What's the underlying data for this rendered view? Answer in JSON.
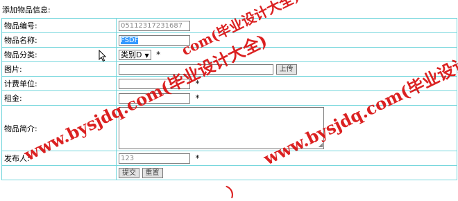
{
  "heading": "添加物品信息:",
  "fields": {
    "code": {
      "label": "物品编号:",
      "value": "05112317231687"
    },
    "name": {
      "label": "物品名称:",
      "value": "FSDF"
    },
    "category": {
      "label": "物品分类:",
      "selected": "类别D"
    },
    "image": {
      "label": "图片:",
      "value": "",
      "upload_label": "上传"
    },
    "unit": {
      "label": "计费单位:",
      "value": ""
    },
    "rent": {
      "label": "租金:",
      "value": ""
    },
    "description": {
      "label": "物品简介:",
      "value": ""
    },
    "publisher": {
      "label": "发布人:",
      "value": "123"
    }
  },
  "required_mark": "*",
  "actions": {
    "submit_label": "提交",
    "reset_label": "重置"
  },
  "watermark": {
    "main": "www.bysjdq.com(毕业设计大全)",
    "fragment_top": "com(毕业设计大全)",
    "fragment_bottom": "）"
  }
}
